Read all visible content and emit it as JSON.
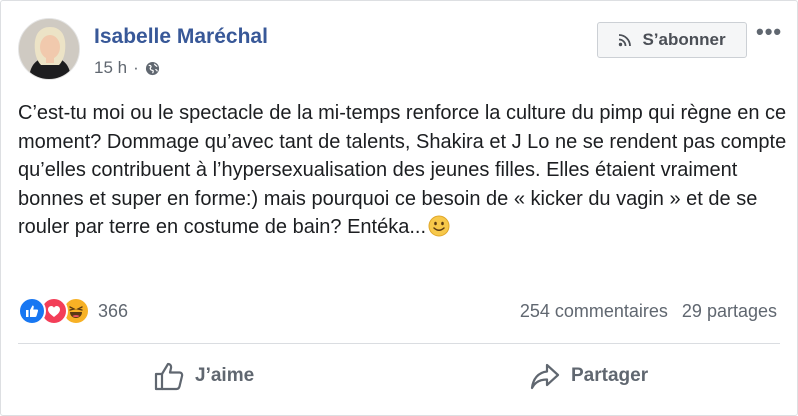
{
  "post": {
    "author": "Isabelle Maréchal",
    "time": "15 h",
    "separator": "·",
    "audience_icon": "globe-icon",
    "subscribe_label": "S’abonner",
    "more_label": "•••",
    "text": "C’est-tu moi ou le spectacle de la mi-temps renforce la culture du pimp qui règne en ce moment? Dommage qu’avec tant de talents, Shakira et J Lo ne se rendent pas compte qu’elles contribuent à l’hypersexualisation des jeunes filles. Elles étaient vraiment bonnes et super en forme:) mais pourquoi ce besoin de « kicker du vagin » et de se rouler par terre en costume de bain? Entéka...",
    "emoji_icon": "slightly-smiling-face-icon"
  },
  "reactions": {
    "types": [
      "like",
      "love",
      "haha"
    ],
    "count": "366"
  },
  "stats": {
    "comments": "254 commentaires",
    "shares": "29 partages"
  },
  "actions": {
    "like_label": "J’aime",
    "share_label": "Partager"
  },
  "colors": {
    "author": "#385898",
    "like_blue": "#1877f2",
    "love_red": "#f33e58",
    "haha_yellow": "#f7b125",
    "secondary_text": "#606770"
  }
}
